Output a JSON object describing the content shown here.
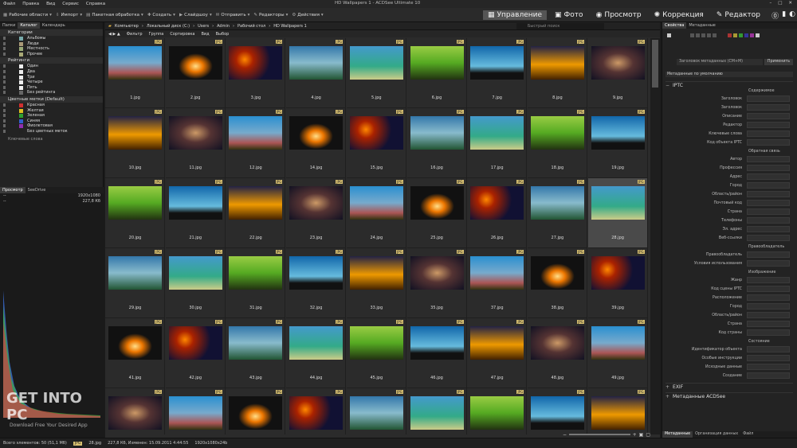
{
  "menu": [
    "Файл",
    "Правка",
    "Вид",
    "Сервис",
    "Справка"
  ],
  "window_title": "HD Wallpapers 1 - ACDSee Ultimate 10",
  "toolbar": {
    "items": [
      "Рабочие области",
      "Импорт",
      "Пакетная обработка",
      "Создать",
      "Слайдшоу",
      "Отправить",
      "Редакторы",
      "Действия"
    ]
  },
  "modes": [
    {
      "label": "Управление",
      "active": true
    },
    {
      "label": "Фото",
      "active": false
    },
    {
      "label": "Просмотр",
      "active": false
    },
    {
      "label": "Коррекция",
      "active": false
    },
    {
      "label": "Редактор",
      "active": false
    }
  ],
  "left_tabs": [
    "Папки",
    "Каталог",
    "Календарь"
  ],
  "categories_header": "Категории",
  "categories": [
    "Альбомы",
    "Люди",
    "Местность",
    "Прочее"
  ],
  "ratings_header": "Рейтинги",
  "ratings": [
    "Один",
    "Два",
    "Три",
    "Четыре",
    "Пять",
    "Без рейтинга"
  ],
  "color_header": "Цветные метки (Default)",
  "color_labels": [
    {
      "label": "Красная",
      "color": "#d03030"
    },
    {
      "label": "Желтая",
      "color": "#e0c020"
    },
    {
      "label": "Зеленая",
      "color": "#30a030"
    },
    {
      "label": "Синяя",
      "color": "#3060d0"
    },
    {
      "label": "Фиолетовая",
      "color": "#9030b0"
    },
    {
      "label": "Без цветных меток",
      "color": "#222222"
    }
  ],
  "keywords_label": "Ключевые слова",
  "preview_tabs": [
    "Просмотр",
    "SeeDrive"
  ],
  "preview_rows": [
    [
      "--",
      "1920x1080"
    ],
    [
      "--",
      "227,8 Кб"
    ]
  ],
  "watermark": "GET INTO PC",
  "watermark_sub": "Download Free Your Desired App",
  "path": [
    "Компьютер",
    "Локальный диск (C:)",
    "Users",
    "Admin",
    "Рабочий стол",
    "HD Wallpapers 1"
  ],
  "quick_search": "Быстрый поиск",
  "filters": [
    "Фильтр",
    "Группа",
    "Сортировка",
    "Вид",
    "Выбор"
  ],
  "files": [
    {
      "name": "1.jpg"
    },
    {
      "name": "2.jpg"
    },
    {
      "name": "3.jpg"
    },
    {
      "name": "4.jpg"
    },
    {
      "name": "5.jpg"
    },
    {
      "name": "6.jpg"
    },
    {
      "name": "7.jpg"
    },
    {
      "name": "8.jpg"
    },
    {
      "name": "9.jpg"
    },
    {
      "name": "10.jpg"
    },
    {
      "name": "11.jpg"
    },
    {
      "name": "12.jpg"
    },
    {
      "name": "14.jpg"
    },
    {
      "name": "15.jpg"
    },
    {
      "name": "16.jpg"
    },
    {
      "name": "17.jpg"
    },
    {
      "name": "18.jpg"
    },
    {
      "name": "19.jpg"
    },
    {
      "name": "20.jpg"
    },
    {
      "name": "21.jpg"
    },
    {
      "name": "22.jpg"
    },
    {
      "name": "23.jpg"
    },
    {
      "name": "24.jpg"
    },
    {
      "name": "25.jpg"
    },
    {
      "name": "26.jpg"
    },
    {
      "name": "27.jpg"
    },
    {
      "name": "28.jpg"
    },
    {
      "name": "29.jpg"
    },
    {
      "name": "30.jpg"
    },
    {
      "name": "31.jpg"
    },
    {
      "name": "32.jpg"
    },
    {
      "name": "33.jpg"
    },
    {
      "name": "35.jpg"
    },
    {
      "name": "37.jpg"
    },
    {
      "name": "38.jpg"
    },
    {
      "name": "39.jpg"
    },
    {
      "name": "41.jpg"
    },
    {
      "name": "42.jpg"
    },
    {
      "name": "43.jpg"
    },
    {
      "name": "44.jpg"
    },
    {
      "name": "45.jpg"
    },
    {
      "name": "46.jpg"
    },
    {
      "name": "47.jpg"
    },
    {
      "name": "48.jpg"
    },
    {
      "name": "49.jpg"
    },
    {
      "name": ""
    },
    {
      "name": ""
    },
    {
      "name": ""
    },
    {
      "name": ""
    },
    {
      "name": ""
    },
    {
      "name": ""
    },
    {
      "name": ""
    },
    {
      "name": ""
    },
    {
      "name": ""
    }
  ],
  "badge": "JPG",
  "selected_file": "28.jpg",
  "right_tabs": [
    "Свойства",
    "Метаданные"
  ],
  "template": "Заголовок метаданных (СМ+М)",
  "apply": "Применить",
  "view_default": "Метаданные по умолчанию",
  "iptc": "IPTC",
  "iptc_groups": [
    "Содержимое",
    "Обратная связь",
    "Правообладатель",
    "Изображение",
    "Состояние"
  ],
  "iptc_fields_1": [
    "Заголовок",
    "Заголовок",
    "Описание",
    "Редактор",
    "Ключевые слова",
    "Код объекта IPTC"
  ],
  "iptc_fields_2": [
    "Автор",
    "Профессия",
    "Адрес",
    "Город",
    "Область/район",
    "Почтовый код",
    "Страна",
    "Телефоны",
    "Эл. адрес",
    "Веб-ссылки"
  ],
  "iptc_fields_3": [
    "Правообладатель",
    "Условия использования"
  ],
  "iptc_fields_4": [
    "Жанр",
    "Код сцены IPTC",
    "Расположение",
    "Город",
    "Область/район",
    "Страна",
    "Код страны"
  ],
  "iptc_fields_5": [
    "Идентификатор объекта",
    "Особые инструкции",
    "Исходные данные",
    "Создание"
  ],
  "exif": "EXIF",
  "acdsee_meta": "Метаданные ACDSee",
  "bottom_tabs": [
    "Метаданные",
    "Организация данных",
    "Файл"
  ],
  "status": {
    "total": "Всего элементов: 50 (51,1 Мб)",
    "tag": "JPG",
    "file": "28.jpg",
    "info": "227,8 Кб, Изменен: 15.09.2011 4:44:55",
    "dims": "1920x1080x24b"
  }
}
